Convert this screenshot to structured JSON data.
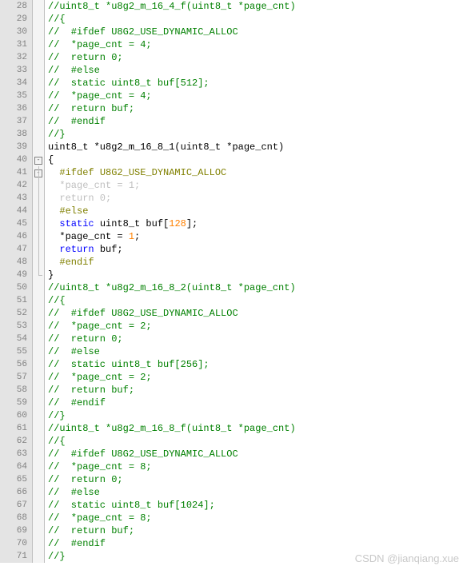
{
  "watermark": "CSDN @jianqiang.xue",
  "lines": [
    {
      "num": 28,
      "fold": "",
      "tokens": [
        {
          "cls": "c-comment",
          "t": "//uint8_t *u8g2_m_16_4_f(uint8_t *page_cnt)"
        }
      ]
    },
    {
      "num": 29,
      "fold": "",
      "tokens": [
        {
          "cls": "c-comment",
          "t": "//{"
        }
      ]
    },
    {
      "num": 30,
      "fold": "",
      "tokens": [
        {
          "cls": "c-comment",
          "t": "//  #ifdef U8G2_USE_DYNAMIC_ALLOC"
        }
      ]
    },
    {
      "num": 31,
      "fold": "",
      "tokens": [
        {
          "cls": "c-comment",
          "t": "//  *page_cnt = 4;"
        }
      ]
    },
    {
      "num": 32,
      "fold": "",
      "tokens": [
        {
          "cls": "c-comment",
          "t": "//  return 0;"
        }
      ]
    },
    {
      "num": 33,
      "fold": "",
      "tokens": [
        {
          "cls": "c-comment",
          "t": "//  #else"
        }
      ]
    },
    {
      "num": 34,
      "fold": "",
      "tokens": [
        {
          "cls": "c-comment",
          "t": "//  static uint8_t buf[512];"
        }
      ]
    },
    {
      "num": 35,
      "fold": "",
      "tokens": [
        {
          "cls": "c-comment",
          "t": "//  *page_cnt = 4;"
        }
      ]
    },
    {
      "num": 36,
      "fold": "",
      "tokens": [
        {
          "cls": "c-comment",
          "t": "//  return buf;"
        }
      ]
    },
    {
      "num": 37,
      "fold": "",
      "tokens": [
        {
          "cls": "c-comment",
          "t": "//  #endif"
        }
      ]
    },
    {
      "num": 38,
      "fold": "",
      "tokens": [
        {
          "cls": "c-comment",
          "t": "//}"
        }
      ]
    },
    {
      "num": 39,
      "fold": "",
      "tokens": [
        {
          "cls": "",
          "t": "uint8_t *u8g2_m_16_8_1(uint8_t *page_cnt)"
        }
      ]
    },
    {
      "num": 40,
      "fold": "minus",
      "tokens": [
        {
          "cls": "",
          "t": "{"
        }
      ]
    },
    {
      "num": 41,
      "fold": "line-minus",
      "tokens": [
        {
          "cls": "",
          "t": "  "
        },
        {
          "cls": "c-directive",
          "t": "#ifdef U8G2_USE_DYNAMIC_ALLOC"
        }
      ]
    },
    {
      "num": 42,
      "fold": "line",
      "tokens": [
        {
          "cls": "c-inactive",
          "t": "  *page_cnt = 1;"
        }
      ]
    },
    {
      "num": 43,
      "fold": "line",
      "tokens": [
        {
          "cls": "c-inactive",
          "t": "  return 0;"
        }
      ]
    },
    {
      "num": 44,
      "fold": "line",
      "tokens": [
        {
          "cls": "",
          "t": "  "
        },
        {
          "cls": "c-directive",
          "t": "#else"
        }
      ]
    },
    {
      "num": 45,
      "fold": "line",
      "tokens": [
        {
          "cls": "",
          "t": "  "
        },
        {
          "cls": "c-keyword",
          "t": "static"
        },
        {
          "cls": "",
          "t": " uint8_t buf["
        },
        {
          "cls": "c-number",
          "t": "128"
        },
        {
          "cls": "",
          "t": "];"
        }
      ]
    },
    {
      "num": 46,
      "fold": "line",
      "tokens": [
        {
          "cls": "",
          "t": "  *page_cnt = "
        },
        {
          "cls": "c-number",
          "t": "1"
        },
        {
          "cls": "",
          "t": ";"
        }
      ]
    },
    {
      "num": 47,
      "fold": "line",
      "tokens": [
        {
          "cls": "",
          "t": "  "
        },
        {
          "cls": "c-keyword",
          "t": "return"
        },
        {
          "cls": "",
          "t": " buf;"
        }
      ]
    },
    {
      "num": 48,
      "fold": "line",
      "tokens": [
        {
          "cls": "",
          "t": "  "
        },
        {
          "cls": "c-directive",
          "t": "#endif"
        }
      ]
    },
    {
      "num": 49,
      "fold": "end",
      "tokens": [
        {
          "cls": "",
          "t": "}"
        }
      ]
    },
    {
      "num": 50,
      "fold": "",
      "tokens": [
        {
          "cls": "c-comment",
          "t": "//uint8_t *u8g2_m_16_8_2(uint8_t *page_cnt)"
        }
      ]
    },
    {
      "num": 51,
      "fold": "",
      "tokens": [
        {
          "cls": "c-comment",
          "t": "//{"
        }
      ]
    },
    {
      "num": 52,
      "fold": "",
      "tokens": [
        {
          "cls": "c-comment",
          "t": "//  #ifdef U8G2_USE_DYNAMIC_ALLOC"
        }
      ]
    },
    {
      "num": 53,
      "fold": "",
      "tokens": [
        {
          "cls": "c-comment",
          "t": "//  *page_cnt = 2;"
        }
      ]
    },
    {
      "num": 54,
      "fold": "",
      "tokens": [
        {
          "cls": "c-comment",
          "t": "//  return 0;"
        }
      ]
    },
    {
      "num": 55,
      "fold": "",
      "tokens": [
        {
          "cls": "c-comment",
          "t": "//  #else"
        }
      ]
    },
    {
      "num": 56,
      "fold": "",
      "tokens": [
        {
          "cls": "c-comment",
          "t": "//  static uint8_t buf[256];"
        }
      ]
    },
    {
      "num": 57,
      "fold": "",
      "tokens": [
        {
          "cls": "c-comment",
          "t": "//  *page_cnt = 2;"
        }
      ]
    },
    {
      "num": 58,
      "fold": "",
      "tokens": [
        {
          "cls": "c-comment",
          "t": "//  return buf;"
        }
      ]
    },
    {
      "num": 59,
      "fold": "",
      "tokens": [
        {
          "cls": "c-comment",
          "t": "//  #endif"
        }
      ]
    },
    {
      "num": 60,
      "fold": "",
      "tokens": [
        {
          "cls": "c-comment",
          "t": "//}"
        }
      ]
    },
    {
      "num": 61,
      "fold": "",
      "tokens": [
        {
          "cls": "c-comment",
          "t": "//uint8_t *u8g2_m_16_8_f(uint8_t *page_cnt)"
        }
      ]
    },
    {
      "num": 62,
      "fold": "",
      "tokens": [
        {
          "cls": "c-comment",
          "t": "//{"
        }
      ]
    },
    {
      "num": 63,
      "fold": "",
      "tokens": [
        {
          "cls": "c-comment",
          "t": "//  #ifdef U8G2_USE_DYNAMIC_ALLOC"
        }
      ]
    },
    {
      "num": 64,
      "fold": "",
      "tokens": [
        {
          "cls": "c-comment",
          "t": "//  *page_cnt = 8;"
        }
      ]
    },
    {
      "num": 65,
      "fold": "",
      "tokens": [
        {
          "cls": "c-comment",
          "t": "//  return 0;"
        }
      ]
    },
    {
      "num": 66,
      "fold": "",
      "tokens": [
        {
          "cls": "c-comment",
          "t": "//  #else"
        }
      ]
    },
    {
      "num": 67,
      "fold": "",
      "tokens": [
        {
          "cls": "c-comment",
          "t": "//  static uint8_t buf[1024];"
        }
      ]
    },
    {
      "num": 68,
      "fold": "",
      "tokens": [
        {
          "cls": "c-comment",
          "t": "//  *page_cnt = 8;"
        }
      ]
    },
    {
      "num": 69,
      "fold": "",
      "tokens": [
        {
          "cls": "c-comment",
          "t": "//  return buf;"
        }
      ]
    },
    {
      "num": 70,
      "fold": "",
      "tokens": [
        {
          "cls": "c-comment",
          "t": "//  #endif"
        }
      ]
    },
    {
      "num": 71,
      "fold": "",
      "tokens": [
        {
          "cls": "c-comment",
          "t": "//}"
        }
      ]
    }
  ]
}
